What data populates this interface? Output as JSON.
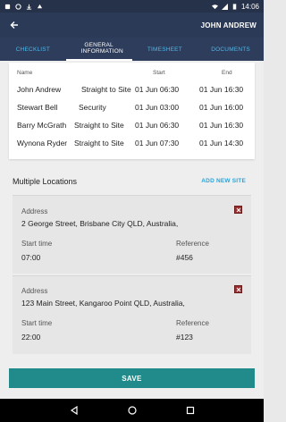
{
  "status_bar": {
    "time": "14:06"
  },
  "app_bar": {
    "user_name": "JOHN ANDREW"
  },
  "tabs": [
    {
      "label": "CHECKLIST",
      "active": false
    },
    {
      "label": "GENERAL INFORMATION",
      "active": true
    },
    {
      "label": "TIMESHEET",
      "active": false
    },
    {
      "label": "DOCUMENTS",
      "active": false
    }
  ],
  "table": {
    "headers": {
      "name": "Name",
      "start": "Start",
      "end": "End"
    },
    "rows": [
      {
        "name": "John Andrew",
        "role": "Straight to Site",
        "start": "01 Jun 06:30",
        "end": "01 Jun 16:30"
      },
      {
        "name": "Stewart Bell",
        "role": "Security",
        "start": "01 Jun 03:00",
        "end": "01 Jun 16:00"
      },
      {
        "name": "Barry McGrath",
        "role": "Straight to Site",
        "start": "01 Jun 06:30",
        "end": "01 Jun 16:30"
      },
      {
        "name": "Wynona Ryder",
        "role": "Straight to Site",
        "start": "01 Jun 07:30",
        "end": "01 Jun 14:30"
      }
    ]
  },
  "multiple_locations": {
    "title": "Multiple Locations",
    "add_label": "ADD NEW SITE",
    "locations": [
      {
        "address_label": "Address",
        "address": "2 George Street, Brisbane City QLD, Australia,",
        "start_label": "Start time",
        "start_time": "07:00",
        "reference_label": "Reference",
        "reference": "#456"
      },
      {
        "address_label": "Address",
        "address": "123 Main Street, Kangaroo Point QLD, Australia,",
        "start_label": "Start time",
        "start_time": "22:00",
        "reference_label": "Reference",
        "reference": "#123"
      }
    ]
  },
  "save_label": "SAVE",
  "colors": {
    "app_bar": "#2b3a57",
    "tab_inactive": "#4fb6e8",
    "accent_link": "#2aa3d9",
    "save_button": "#218a8a",
    "delete_icon": "#9a2e2e"
  }
}
